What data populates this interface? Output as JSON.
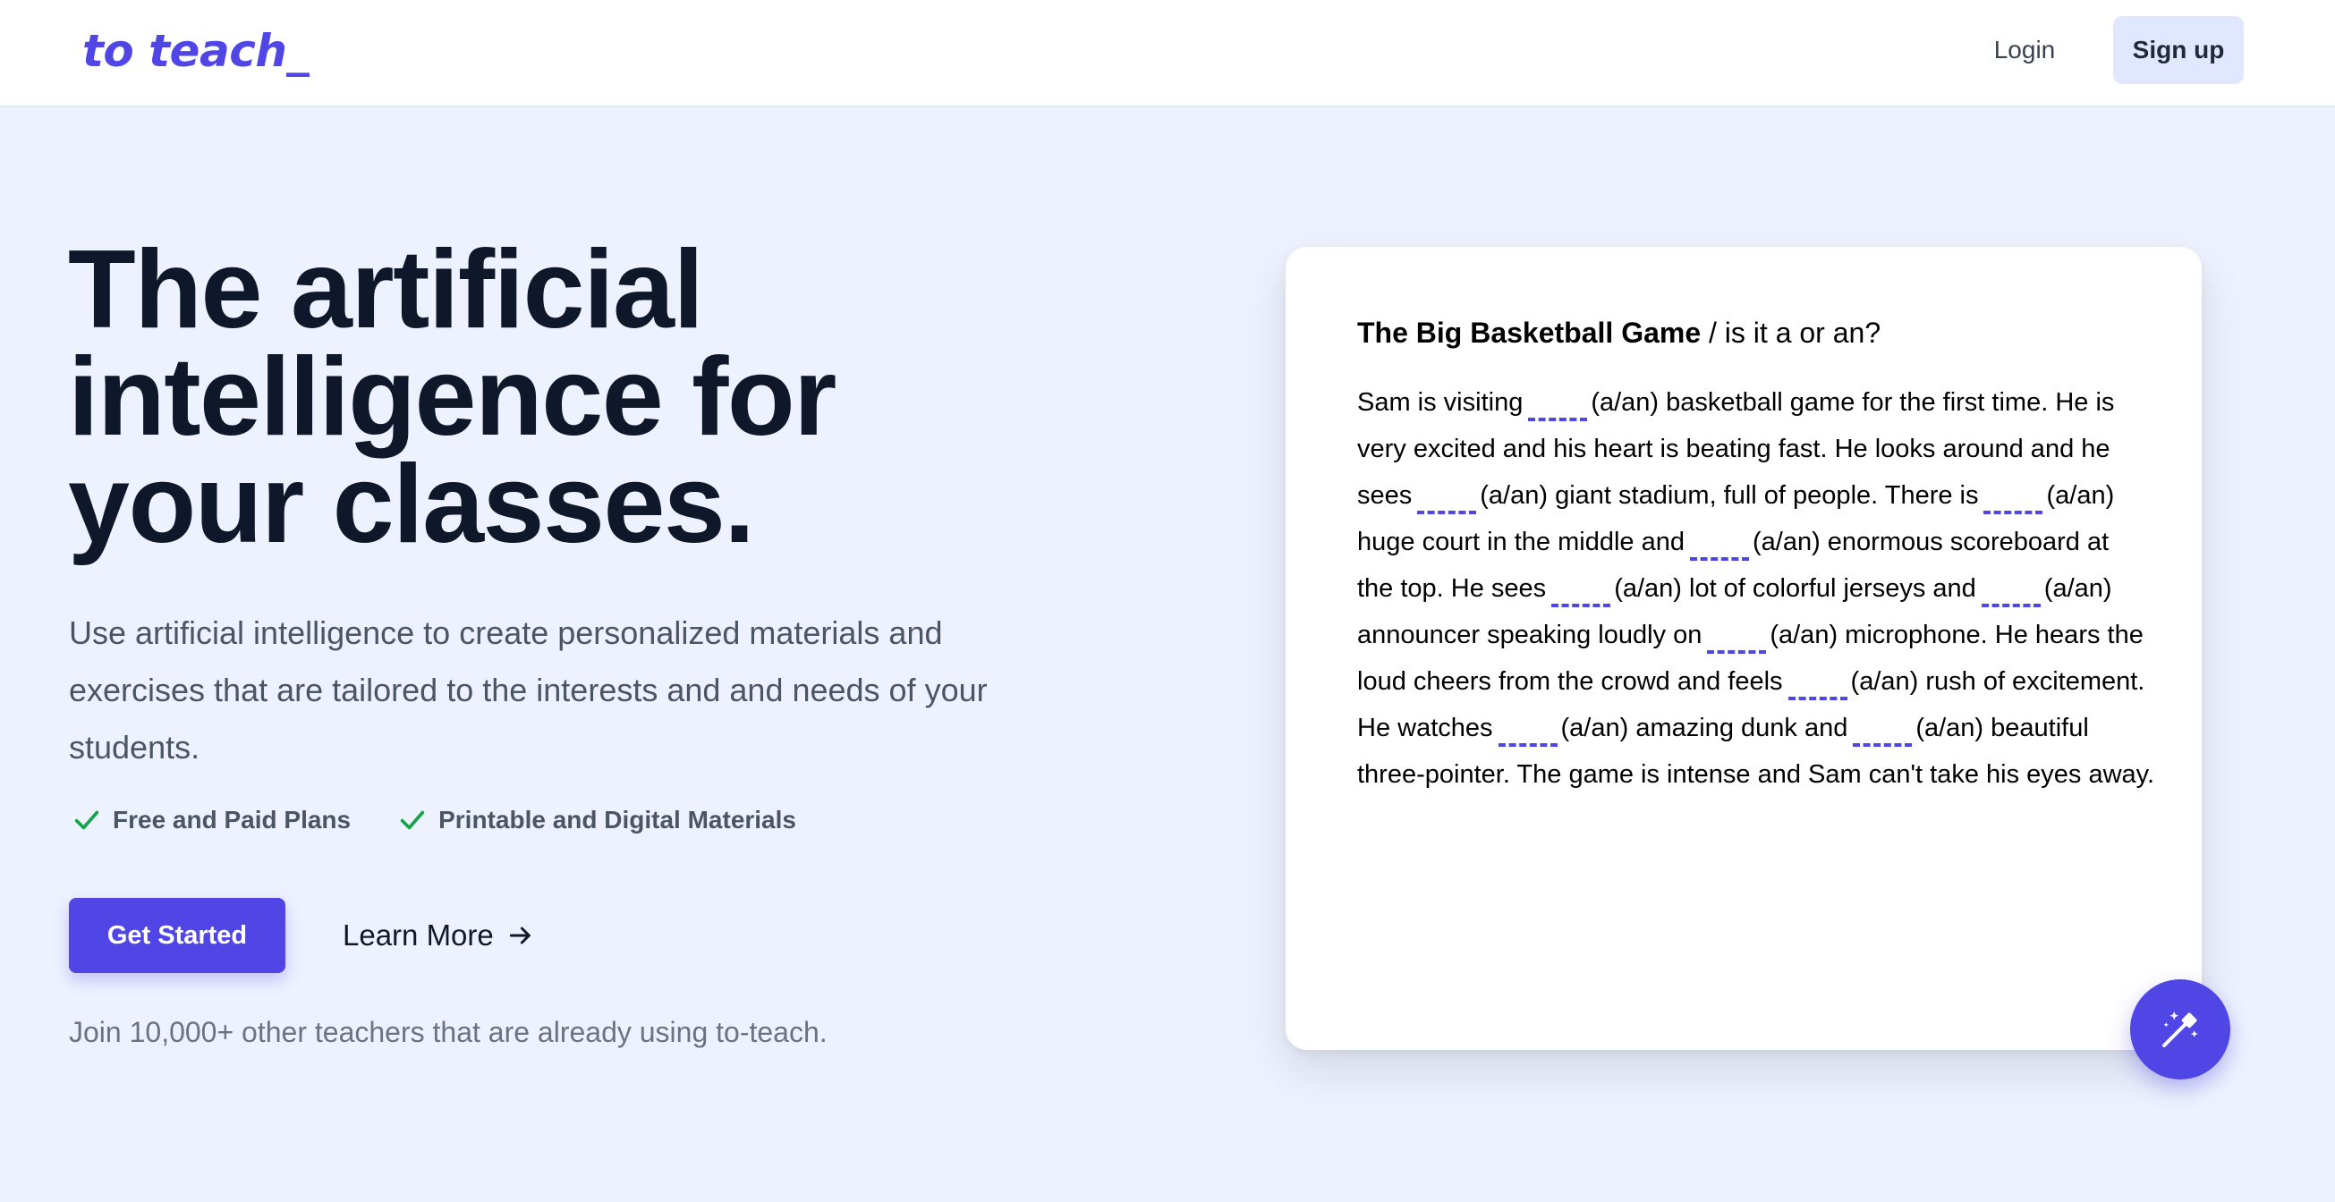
{
  "header": {
    "logo": "to teach_",
    "login_label": "Login",
    "signup_label": "Sign up"
  },
  "hero": {
    "title_lines": [
      "The artificial",
      "intelligence for",
      "your classes."
    ],
    "subtitle": "Use artificial intelligence to create personalized materials and exercises that are tailored to the interests and and needs of your students.",
    "features": [
      {
        "icon": "check-icon",
        "label": "Free and Paid Plans"
      },
      {
        "icon": "check-icon",
        "label": "Printable and Digital Materials"
      }
    ],
    "primary_cta": "Get Started",
    "secondary_cta": "Learn More",
    "social_proof": "Join 10,000+ other teachers that are already using to-teach."
  },
  "worksheet": {
    "title": "The Big Basketball Game",
    "title_separator": " / is it a or an?",
    "blank_hint": "(a/an)",
    "lines": [
      [
        {
          "t": "Sam is visiting"
        },
        {
          "b": 1
        },
        {
          "t": "(a/an) basketball game for the first time. He is"
        }
      ],
      [
        {
          "t": "very excited and his heart is beating fast. He looks around and he"
        }
      ],
      [
        {
          "t": "sees"
        },
        {
          "b": 1
        },
        {
          "t": "(a/an) giant stadium, full of people. There is"
        },
        {
          "b": 1
        },
        {
          "t": "(a/an)"
        }
      ],
      [
        {
          "t": "huge court in the middle and"
        },
        {
          "b": 1
        },
        {
          "t": "(a/an) enormous scoreboard at"
        }
      ],
      [
        {
          "t": "the top. He sees"
        },
        {
          "b": 1
        },
        {
          "t": "(a/an) lot of colorful jerseys and"
        },
        {
          "b": 1
        },
        {
          "t": "(a/an)"
        }
      ],
      [
        {
          "t": "announcer speaking loudly on"
        },
        {
          "b": 1
        },
        {
          "t": "(a/an) microphone. He hears the"
        }
      ],
      [
        {
          "t": "loud cheers from the crowd and feels"
        },
        {
          "b": 1
        },
        {
          "t": "(a/an) rush of excitement."
        }
      ],
      [
        {
          "t": "He watches"
        },
        {
          "b": 1
        },
        {
          "t": "(a/an) amazing dunk and"
        },
        {
          "b": 1
        },
        {
          "t": "(a/an) beautiful"
        }
      ],
      [
        {
          "t": "three-pointer. The game is intense and Sam can't take his eyes away."
        }
      ]
    ],
    "fab_icon": "magic-wand-icon"
  },
  "colors": {
    "accent": "#4f46e5",
    "page_bg": "#eef2fe",
    "check": "#16a34a",
    "signup_bg": "#e0e7ff"
  }
}
